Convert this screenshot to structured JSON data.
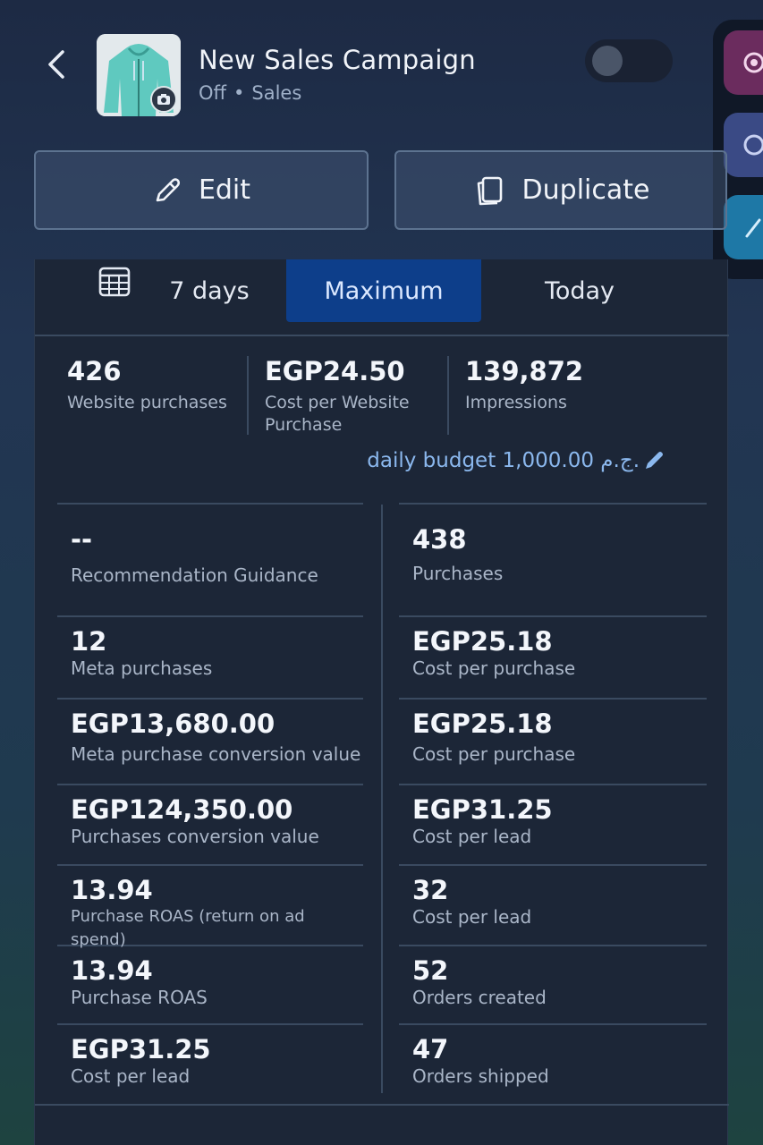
{
  "header": {
    "title": "New Sales Campaign",
    "status": "Off",
    "separator": "•",
    "objective": "Sales"
  },
  "actions": {
    "edit_label": "Edit",
    "duplicate_label": "Duplicate"
  },
  "tabs": [
    {
      "label": "7 days"
    },
    {
      "label": "Maximum",
      "selected": true
    },
    {
      "label": "Today"
    }
  ],
  "kpis": [
    {
      "value": "426",
      "label": "Website purchases"
    },
    {
      "value": "EGP24.50",
      "label": "Cost per Website Purchase"
    },
    {
      "value": "139,872",
      "label": "Impressions"
    }
  ],
  "budget": {
    "text": "daily budget 1,000.00 ج.م."
  },
  "metrics_left": [
    {
      "value": "--",
      "label": "Recommendation Guidance"
    },
    {
      "value": "12",
      "label": "Meta purchases"
    },
    {
      "value": "EGP13,680.00",
      "label": "Meta purchase conversion value"
    },
    {
      "value": "EGP124,350.00",
      "label": "Purchases conversion value"
    },
    {
      "value": "13.94",
      "label": "Purchase ROAS (return on ad spend)"
    },
    {
      "value": "13.94",
      "label": "Purchase ROAS"
    },
    {
      "value": "EGP31.25",
      "label": "Cost per lead"
    }
  ],
  "metrics_right": [
    {
      "value": "438",
      "label": "Purchases"
    },
    {
      "value": "EGP25.18",
      "label": "Cost per purchase"
    },
    {
      "value": "EGP25.18",
      "label": "Cost per purchase"
    },
    {
      "value": "EGP31.25",
      "label": "Cost per lead"
    },
    {
      "value": "32",
      "label": "Cost per lead"
    },
    {
      "value": "52",
      "label": "Orders created"
    },
    {
      "value": "47",
      "label": "Orders shipped"
    }
  ],
  "colors": {
    "accent": "#0d3e8a",
    "link": "#8bb8ee",
    "panel": "#1c2637"
  }
}
